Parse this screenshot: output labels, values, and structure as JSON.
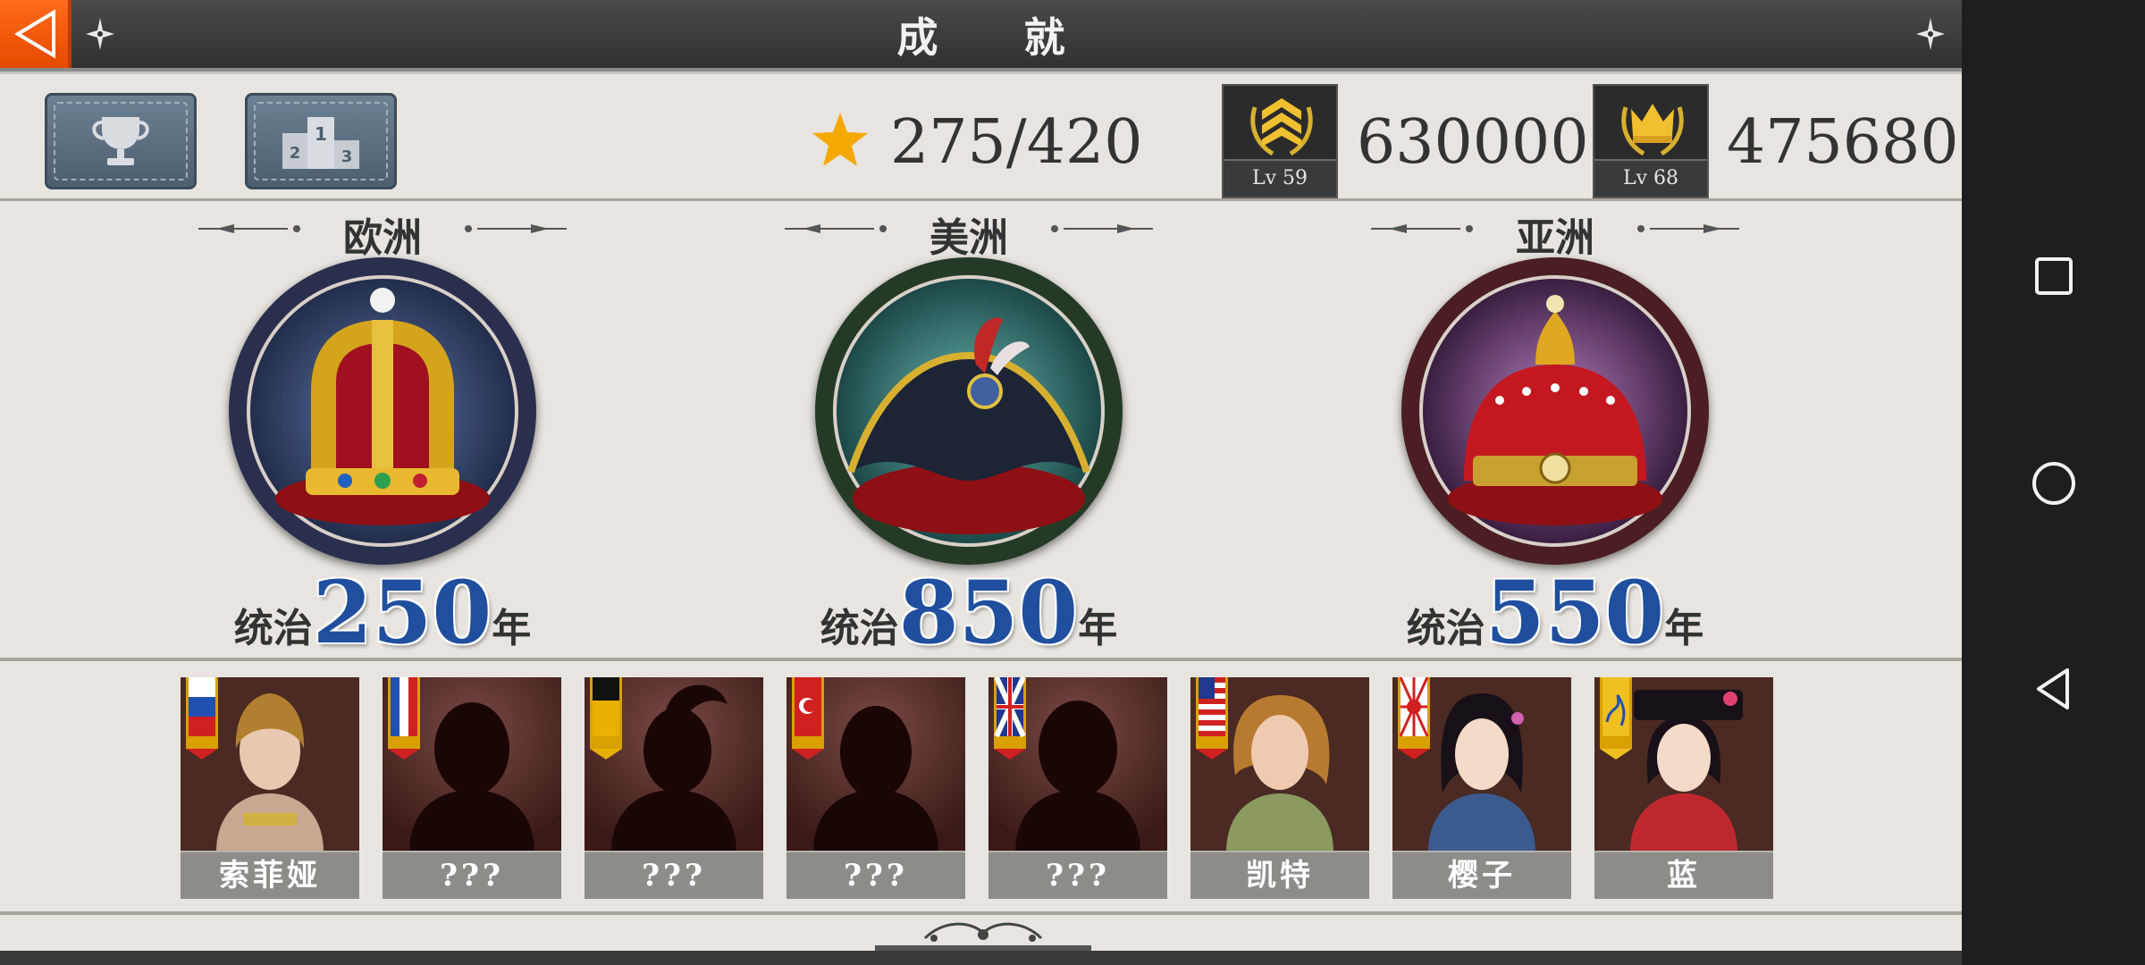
{
  "header": {
    "title": "成 就"
  },
  "stats": {
    "stars": "275/420",
    "rank1": {
      "score": "630000",
      "level": "Lv 59"
    },
    "rank2": {
      "score": "475680",
      "level": "Lv 68"
    }
  },
  "continents": [
    {
      "name": "欧洲",
      "reign_prefix": "统治",
      "years": "250",
      "unit": "年",
      "ring_color": "#2a2f4e"
    },
    {
      "name": "美洲",
      "reign_prefix": "统治",
      "years": "850",
      "unit": "年",
      "ring_color": "#253a26"
    },
    {
      "name": "亚洲",
      "reign_prefix": "统治",
      "years": "550",
      "unit": "年",
      "ring_color": "#4a1e22"
    }
  ],
  "characters": [
    {
      "name": "索菲娅",
      "flag": "russia",
      "unlocked": true
    },
    {
      "name": "???",
      "flag": "france",
      "unlocked": false
    },
    {
      "name": "???",
      "flag": "germany",
      "unlocked": false
    },
    {
      "name": "???",
      "flag": "turkey",
      "unlocked": false
    },
    {
      "name": "???",
      "flag": "uk",
      "unlocked": false
    },
    {
      "name": "凯特",
      "flag": "usa",
      "unlocked": true
    },
    {
      "name": "樱子",
      "flag": "japan",
      "unlocked": true
    },
    {
      "name": "蓝",
      "flag": "qing",
      "unlocked": true
    }
  ],
  "colors": {
    "accent_orange": "#f05a0c",
    "reign_blue": "#1f4f9e",
    "star_gold": "#f5a800"
  }
}
